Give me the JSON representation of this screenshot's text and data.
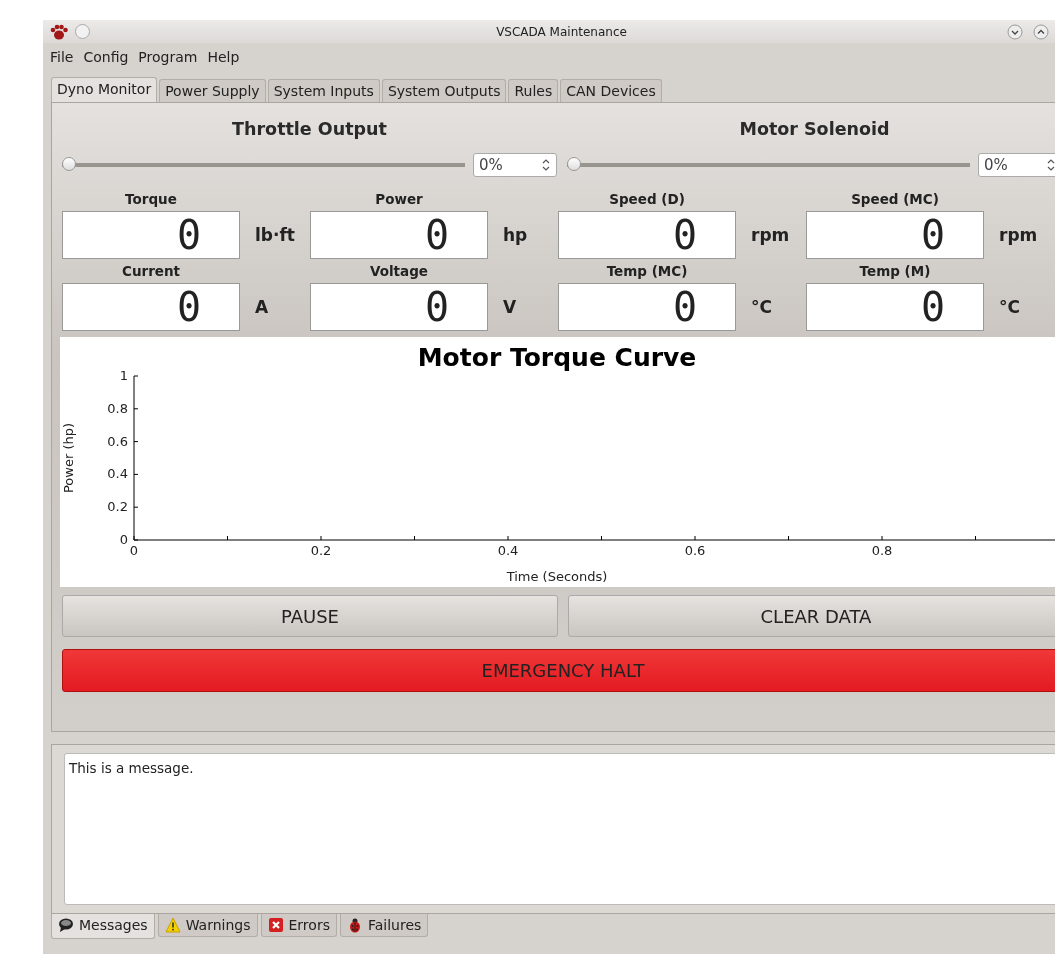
{
  "window": {
    "title": "VSCADA Maintenance"
  },
  "menu": [
    "File",
    "Config",
    "Program",
    "Help"
  ],
  "tabs": [
    {
      "label": "Dyno Monitor",
      "selected": true
    },
    {
      "label": "Power Supply",
      "selected": false
    },
    {
      "label": "System Inputs",
      "selected": false
    },
    {
      "label": "System Outputs",
      "selected": false
    },
    {
      "label": "Rules",
      "selected": false
    },
    {
      "label": "CAN Devices",
      "selected": false
    }
  ],
  "controls": [
    {
      "title": "Throttle Output",
      "level": 0,
      "value": "0%"
    },
    {
      "title": "Motor Solenoid",
      "level": 0,
      "value": "0%"
    }
  ],
  "readouts": [
    {
      "label": "Torque",
      "value": "0",
      "unit": "lb·ft"
    },
    {
      "label": "Power",
      "value": "0",
      "unit": "hp"
    },
    {
      "label": "Speed (D)",
      "value": "0",
      "unit": "rpm"
    },
    {
      "label": "Speed (MC)",
      "value": "0",
      "unit": "rpm"
    },
    {
      "label": "Current",
      "value": "0",
      "unit": "A"
    },
    {
      "label": "Voltage",
      "value": "0",
      "unit": "V"
    },
    {
      "label": "Temp (MC)",
      "value": "0",
      "unit": "°C"
    },
    {
      "label": "Temp (M)",
      "value": "0",
      "unit": "°C"
    }
  ],
  "chart": {
    "chart_data": {
      "type": "line",
      "title": "Motor Torque Curve",
      "xlabel": "Time (Seconds)",
      "ylabel": "Power (hp)",
      "xlim": [
        0,
        0.985
      ],
      "ylim": [
        0,
        1
      ],
      "xticks": [
        0,
        0.2,
        0.4,
        0.6,
        0.8
      ],
      "yticks": [
        0,
        0.2,
        0.4,
        0.6,
        0.8,
        1
      ]
    }
  },
  "buttons": [
    {
      "label": "PAUSE",
      "kind": "normal"
    },
    {
      "label": "CLEAR DATA",
      "kind": "normal"
    },
    {
      "label": "EMERGENCY HALT",
      "kind": "danger"
    }
  ],
  "message_log": {
    "text": "This is a message."
  },
  "log_tabs": [
    {
      "label": "Messages",
      "kind": "message",
      "selected": true
    },
    {
      "label": "Warnings",
      "kind": "warning",
      "selected": false
    },
    {
      "label": "Errors",
      "kind": "error",
      "selected": false
    },
    {
      "label": "Failures",
      "kind": "failure",
      "selected": false
    }
  ]
}
